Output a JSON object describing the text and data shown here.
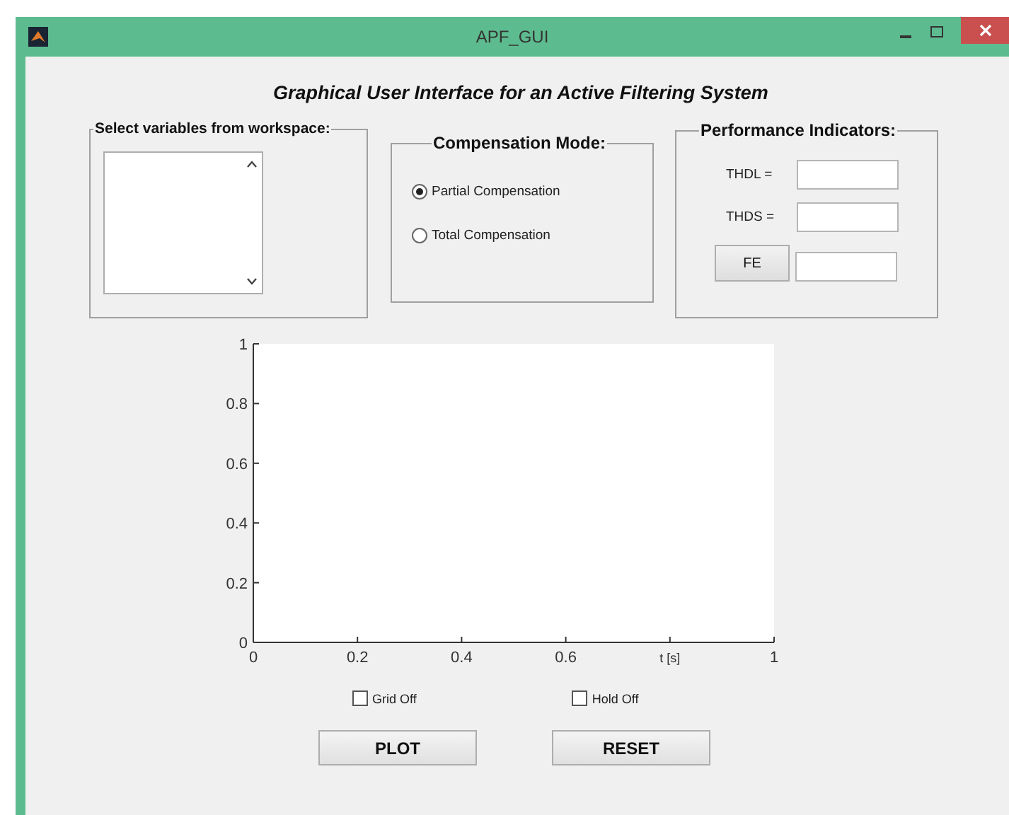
{
  "window": {
    "title": "APF_GUI"
  },
  "heading": "Graphical User Interface for an Active Filtering System",
  "variables_panel": {
    "title": "Select variables from workspace:"
  },
  "mode_panel": {
    "title": "Compensation Mode:",
    "options": [
      {
        "label": "Partial Compensation",
        "selected": true
      },
      {
        "label": "Total Compensation",
        "selected": false
      }
    ]
  },
  "indicators_panel": {
    "title": "Performance Indicators:",
    "rows": [
      {
        "kind": "label",
        "label": "THDL ="
      },
      {
        "kind": "label",
        "label": "THDS ="
      },
      {
        "kind": "button",
        "label": "FE"
      }
    ]
  },
  "chart": {
    "chart_data": {
      "type": "line",
      "xlim": [
        0,
        1
      ],
      "ylim": [
        0,
        1
      ],
      "xticks": [
        0,
        0.2,
        0.4,
        0.6,
        {
          "value": 0.8,
          "label": "t [s]"
        },
        1
      ],
      "yticks": [
        0,
        0.2,
        0.4,
        0.6,
        0.8,
        1
      ]
    }
  },
  "checkboxes": [
    {
      "label": "Grid Off",
      "checked": false
    },
    {
      "label": "Hold Off",
      "checked": false
    }
  ],
  "buttons": [
    "PLOT",
    "RESET"
  ]
}
